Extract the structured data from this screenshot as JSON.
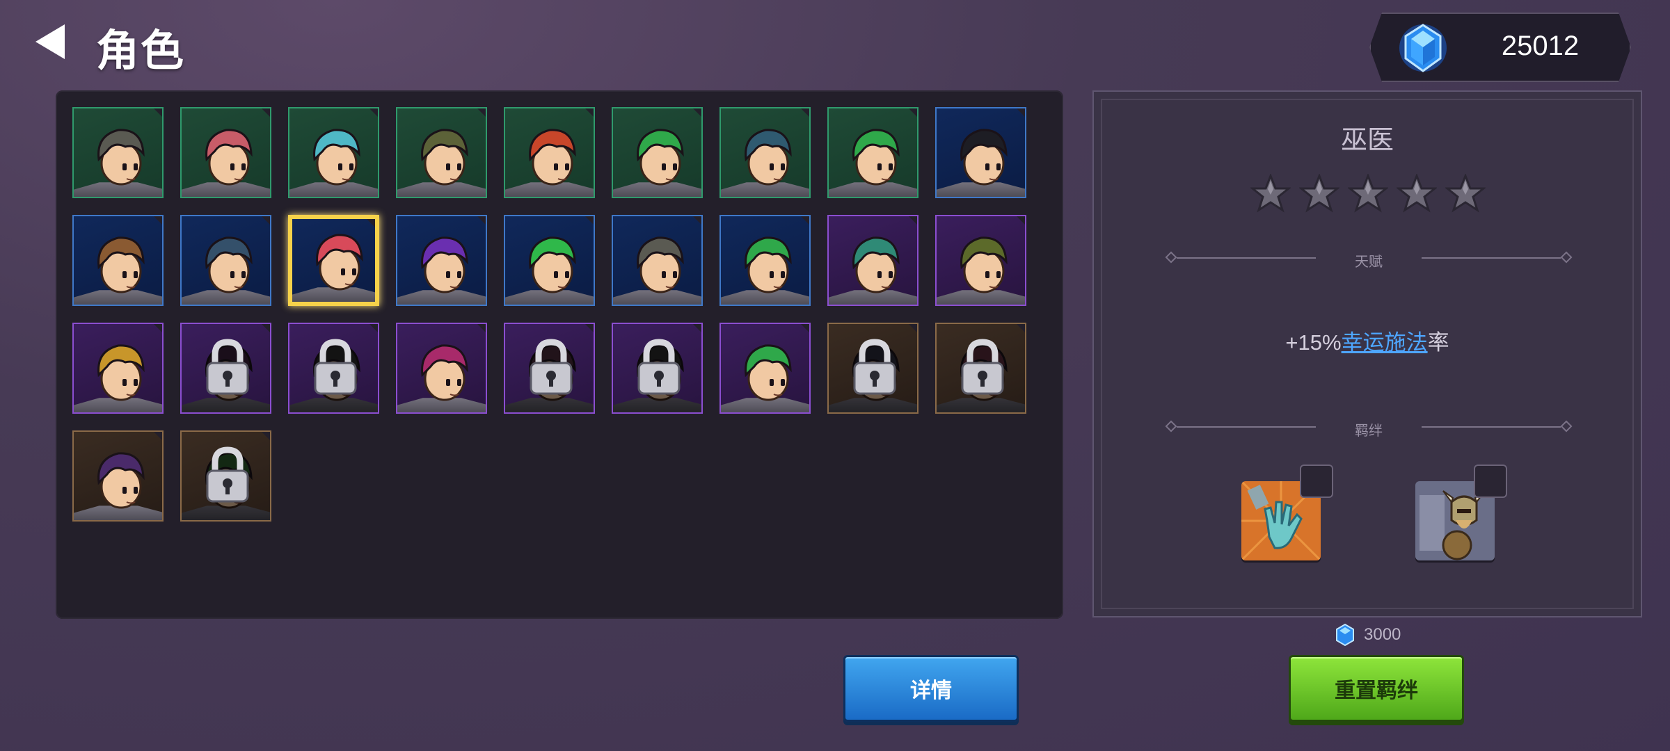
{
  "header": {
    "title": "角色",
    "gem_count": "25012"
  },
  "heroes": [
    {
      "rarity": "green",
      "hair": "#5a5a52",
      "locked": false,
      "selected": false
    },
    {
      "rarity": "green",
      "hair": "#c85c68",
      "locked": false,
      "selected": false
    },
    {
      "rarity": "green",
      "hair": "#4fb8c6",
      "locked": false,
      "selected": false
    },
    {
      "rarity": "green",
      "hair": "#5c6238",
      "locked": false,
      "selected": false
    },
    {
      "rarity": "green",
      "hair": "#c8462a",
      "locked": false,
      "selected": false
    },
    {
      "rarity": "green",
      "hair": "#2fa84a",
      "locked": false,
      "selected": false
    },
    {
      "rarity": "green",
      "hair": "#2f5a70",
      "locked": false,
      "selected": false
    },
    {
      "rarity": "green",
      "hair": "#2fa84a",
      "locked": false,
      "selected": false
    },
    {
      "rarity": "blue",
      "hair": "#1d1d24",
      "locked": false,
      "selected": false
    },
    {
      "rarity": "blue",
      "hair": "#8a5a32",
      "locked": false,
      "selected": false
    },
    {
      "rarity": "blue",
      "hair": "#34506a",
      "locked": false,
      "selected": false
    },
    {
      "rarity": "blue",
      "hair": "#d84a5a",
      "locked": false,
      "selected": true
    },
    {
      "rarity": "blue",
      "hair": "#6a2fb0",
      "locked": false,
      "selected": false
    },
    {
      "rarity": "blue",
      "hair": "#2fb84a",
      "locked": false,
      "selected": false
    },
    {
      "rarity": "blue",
      "hair": "#5a5a52",
      "locked": false,
      "selected": false
    },
    {
      "rarity": "blue",
      "hair": "#2fa84a",
      "locked": false,
      "selected": false
    },
    {
      "rarity": "purple",
      "hair": "#2f8a76",
      "locked": false,
      "selected": false
    },
    {
      "rarity": "purple",
      "hair": "#5c6a2a",
      "locked": false,
      "selected": false
    },
    {
      "rarity": "purple",
      "hair": "#c8962a",
      "locked": false,
      "selected": false
    },
    {
      "rarity": "purple",
      "hair": "#3a1e3a",
      "locked": true,
      "selected": false
    },
    {
      "rarity": "purple",
      "hair": "#2a2a2a",
      "locked": true,
      "selected": false
    },
    {
      "rarity": "purple",
      "hair": "#a82a6a",
      "locked": false,
      "selected": false
    },
    {
      "rarity": "purple",
      "hair": "#4a2a3a",
      "locked": true,
      "selected": false
    },
    {
      "rarity": "purple",
      "hair": "#2a2a2a",
      "locked": true,
      "selected": false
    },
    {
      "rarity": "purple",
      "hair": "#2fa84a",
      "locked": false,
      "selected": false
    },
    {
      "rarity": "brown",
      "hair": "#2a2a3a",
      "locked": true,
      "selected": false
    },
    {
      "rarity": "brown",
      "hair": "#5a2a3a",
      "locked": true,
      "selected": false
    },
    {
      "rarity": "brown",
      "hair": "#4a2a6a",
      "locked": false,
      "selected": false
    },
    {
      "rarity": "brown",
      "hair": "#2a5a2a",
      "locked": true,
      "selected": false
    }
  ],
  "detail": {
    "hero_name": "巫医",
    "stars_filled": 0,
    "stars_total": 5,
    "talent_label": "天赋",
    "talent_prefix": "+15%",
    "talent_link": "幸运施法",
    "talent_suffix": "率",
    "bond_label": "羁绊",
    "bonds": [
      {
        "icon": "zombie-hand-icon"
      },
      {
        "icon": "viking-warrior-icon"
      }
    ]
  },
  "actions": {
    "reset_cost": "3000",
    "details_label": "详情",
    "reset_label": "重置羁绊"
  },
  "colors": {
    "gem": "#4fb8ff",
    "selected_border": "#f6d24a",
    "link": "#4ea6ff"
  }
}
